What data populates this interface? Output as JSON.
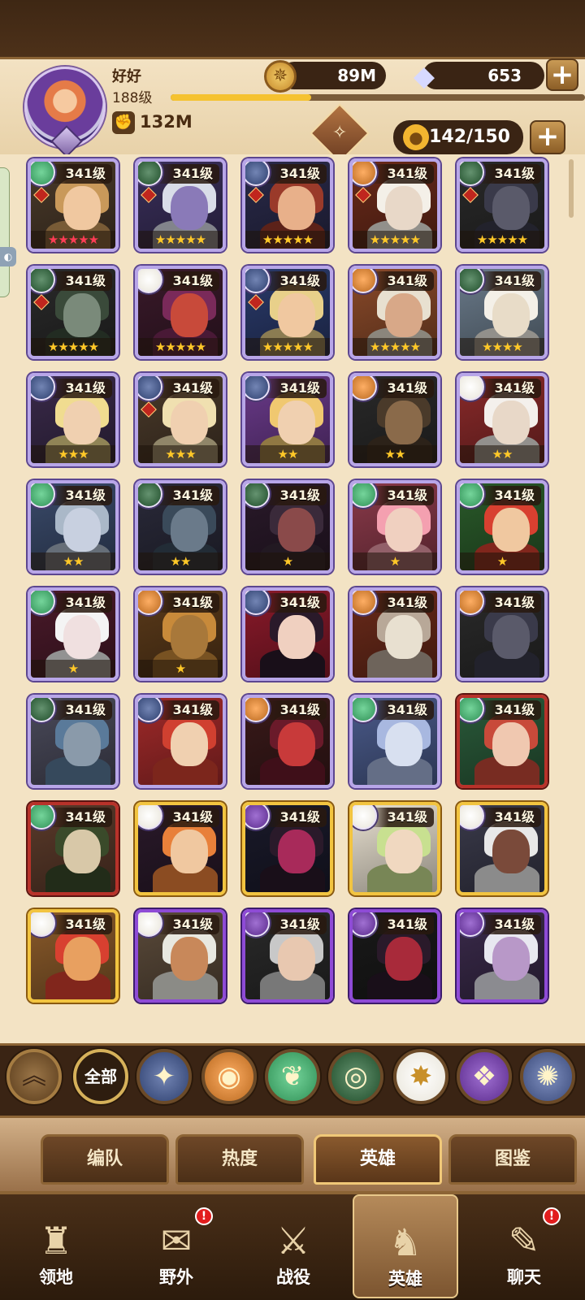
{
  "player": {
    "name": "好好",
    "level": "188级",
    "power": "132M",
    "xp_fraction": 0.34
  },
  "resources": {
    "gold": "89M",
    "diamonds": "653"
  },
  "hero_count": "142/150",
  "level_label": "341级",
  "heroes": [
    {
      "stars": "★★★★★",
      "star_color": "red",
      "faction": "green",
      "frame": "silver"
    },
    {
      "stars": "★★★★★",
      "star_color": "gold",
      "faction": "darkgreen",
      "frame": "silver"
    },
    {
      "stars": "★★★★★",
      "star_color": "gold",
      "faction": "blue",
      "frame": "silver"
    },
    {
      "stars": "★★★★★",
      "star_color": "gold",
      "faction": "orange",
      "frame": "silver"
    },
    {
      "stars": "★★★★★",
      "star_color": "gold",
      "faction": "darkgreen",
      "frame": "silver"
    },
    {
      "stars": "★★★★★",
      "star_color": "gold",
      "faction": "darkgreen",
      "frame": "silver"
    },
    {
      "stars": "★★★★★",
      "star_color": "gold",
      "faction": "light",
      "frame": "silver"
    },
    {
      "stars": "★★★★★",
      "star_color": "gold",
      "faction": "blue",
      "frame": "silver"
    },
    {
      "stars": "★★★★★",
      "star_color": "gold",
      "faction": "orange",
      "frame": "silver"
    },
    {
      "stars": "★★★★",
      "star_color": "gold",
      "faction": "darkgreen",
      "frame": "silver"
    },
    {
      "stars": "★★★",
      "star_color": "gold",
      "faction": "blue",
      "frame": "silver"
    },
    {
      "stars": "★★★",
      "star_color": "gold",
      "faction": "blue",
      "frame": "silver"
    },
    {
      "stars": "★★",
      "star_color": "gold",
      "faction": "blue",
      "frame": "silver"
    },
    {
      "stars": "★★",
      "star_color": "gold",
      "faction": "orange",
      "frame": "silver"
    },
    {
      "stars": "★★",
      "star_color": "gold",
      "faction": "light",
      "frame": "silver"
    },
    {
      "stars": "★★",
      "star_color": "gold",
      "faction": "green",
      "frame": "silver"
    },
    {
      "stars": "★★",
      "star_color": "gold",
      "faction": "darkgreen",
      "frame": "silver"
    },
    {
      "stars": "★",
      "star_color": "gold",
      "faction": "darkgreen",
      "frame": "silver"
    },
    {
      "stars": "★",
      "star_color": "gold",
      "faction": "green",
      "frame": "silver"
    },
    {
      "stars": "★",
      "star_color": "gold",
      "faction": "green",
      "frame": "silver"
    },
    {
      "stars": "★",
      "star_color": "gold",
      "faction": "green",
      "frame": "silver"
    },
    {
      "stars": "★",
      "star_color": "gold",
      "faction": "orange",
      "frame": "silver"
    },
    {
      "stars": "",
      "star_color": "gold",
      "faction": "blue",
      "frame": "silver"
    },
    {
      "stars": "",
      "star_color": "gold",
      "faction": "orange",
      "frame": "silver"
    },
    {
      "stars": "",
      "star_color": "gold",
      "faction": "orange",
      "frame": "silver"
    },
    {
      "stars": "",
      "star_color": "gold",
      "faction": "darkgreen",
      "frame": "silver"
    },
    {
      "stars": "",
      "star_color": "gold",
      "faction": "blue",
      "frame": "silver"
    },
    {
      "stars": "",
      "star_color": "gold",
      "faction": "orange",
      "frame": "silver"
    },
    {
      "stars": "",
      "star_color": "gold",
      "faction": "green",
      "frame": "silver"
    },
    {
      "stars": "",
      "star_color": "gold",
      "faction": "green",
      "frame": "red"
    },
    {
      "stars": "",
      "star_color": "gold",
      "faction": "green",
      "frame": "red"
    },
    {
      "stars": "",
      "star_color": "gold",
      "faction": "light",
      "frame": "gold"
    },
    {
      "stars": "",
      "star_color": "gold",
      "faction": "purple",
      "frame": "gold"
    },
    {
      "stars": "",
      "star_color": "gold",
      "faction": "light",
      "frame": "gold"
    },
    {
      "stars": "",
      "star_color": "gold",
      "faction": "light",
      "frame": "gold"
    },
    {
      "stars": "",
      "star_color": "gold",
      "faction": "light",
      "frame": "gold"
    },
    {
      "stars": "",
      "star_color": "gold",
      "faction": "light",
      "frame": "purple"
    },
    {
      "stars": "",
      "star_color": "gold",
      "faction": "purple",
      "frame": "purple"
    },
    {
      "stars": "",
      "star_color": "gold",
      "faction": "purple",
      "frame": "purple"
    },
    {
      "stars": "",
      "star_color": "gold",
      "faction": "purple",
      "frame": "purple"
    }
  ],
  "filters": {
    "all_label": "全部",
    "icons": [
      "collapse-icon",
      "all",
      "lightbearer-icon",
      "mauler-icon",
      "wilder-icon",
      "graveborn-icon",
      "celestial-icon",
      "hypogean-icon",
      "dimensional-icon"
    ]
  },
  "colors": {
    "green": "#2f8f55",
    "darkgreen": "#1f4d2a",
    "blue": "#2d3f6e",
    "orange": "#b8681e",
    "light": "#e8e4d8",
    "purple": "#5a2a8c"
  },
  "subtabs": [
    "编队",
    "热度",
    "英雄",
    "图鉴"
  ],
  "active_subtab": 2,
  "nav": [
    {
      "label": "领地",
      "icon": "castle-icon",
      "badge": false
    },
    {
      "label": "野外",
      "icon": "scroll-map-icon",
      "badge": true
    },
    {
      "label": "战役",
      "icon": "crossed-swords-icon",
      "badge": false
    },
    {
      "label": "英雄",
      "icon": "helmet-icon",
      "badge": false
    },
    {
      "label": "聊天",
      "icon": "chat-icon",
      "badge": true
    }
  ],
  "active_nav": 3,
  "badge_text": "!"
}
